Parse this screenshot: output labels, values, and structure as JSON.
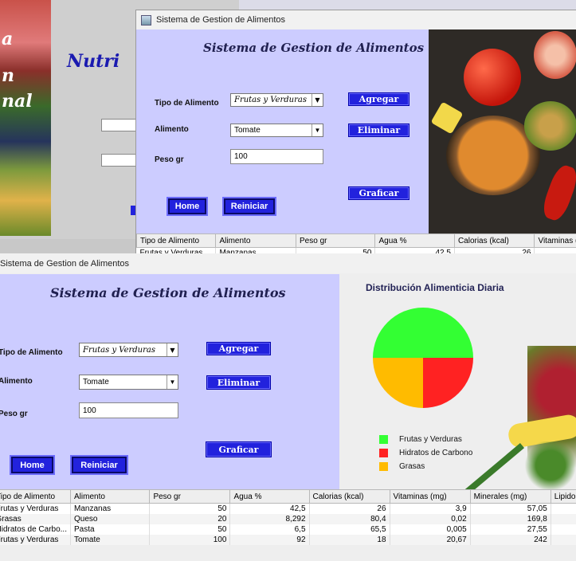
{
  "background_window": {
    "image_text": [
      "a",
      "n",
      "nal"
    ],
    "title_partial": "Nutri"
  },
  "window1": {
    "title": "Sistema de Gestion de Alimentos",
    "heading": "Sistema de Gestion de Alimentos",
    "labels": {
      "tipo": "Tipo de Alimento",
      "alimento": "Alimento",
      "peso": "Peso gr"
    },
    "tipo_value": "Frutas y Verduras",
    "alimento_value": "Tomate",
    "peso_value": "100",
    "buttons": {
      "agregar": "Agregar",
      "eliminar": "Eliminar",
      "graficar": "Graficar",
      "home": "Home",
      "reiniciar": "Reiniciar"
    },
    "table": {
      "columns": [
        "Tipo de Alimento",
        "Alimento",
        "Peso gr",
        "Agua %",
        "Calorias (kcal)",
        "Vitaminas (mg)"
      ],
      "first_row_partial": [
        "Frutas y Verduras",
        "Manzanas",
        "50",
        "42,5",
        "26",
        ""
      ]
    }
  },
  "window2": {
    "title": "Sistema de Gestion de Alimentos",
    "heading": "Sistema de Gestion de Alimentos",
    "labels": {
      "tipo": "Tipo de Alimento",
      "alimento": "Alimento",
      "peso": "Peso gr"
    },
    "tipo_value": "Frutas y Verduras",
    "alimento_value": "Tomate",
    "peso_value": "100",
    "buttons": {
      "agregar": "Agregar",
      "eliminar": "Eliminar",
      "graficar": "Graficar",
      "home": "Home",
      "reiniciar": "Reiniciar"
    },
    "table": {
      "columns": [
        "Tipo de Alimento",
        "Alimento",
        "Peso gr",
        "Agua %",
        "Calorias (kcal)",
        "Vitaminas (mg)",
        "Minerales (mg)",
        "Lipido"
      ],
      "rows": [
        [
          "Frutas y Verduras",
          "Manzanas",
          "50",
          "42,5",
          "26",
          "3,9",
          "57,05"
        ],
        [
          "Grasas",
          "Queso",
          "20",
          "8,292",
          "80,4",
          "0,02",
          "169,8"
        ],
        [
          "Hidratos de Carbo...",
          "Pasta",
          "50",
          "6,5",
          "65,5",
          "0,005",
          "27,55"
        ],
        [
          "Frutas y Verduras",
          "Tomate",
          "100",
          "92",
          "18",
          "20,67",
          "242"
        ]
      ]
    }
  },
  "chart_data": {
    "type": "pie",
    "title": "Distribución Alimenticia Diaria",
    "categories": [
      "Frutas y Verduras",
      "Hidratos de Carbono",
      "Grasas"
    ],
    "values": [
      50,
      25,
      25
    ],
    "colors": [
      "#33ff33",
      "#ff2222",
      "#ffbb00"
    ],
    "legend_position": "bottom-left"
  }
}
